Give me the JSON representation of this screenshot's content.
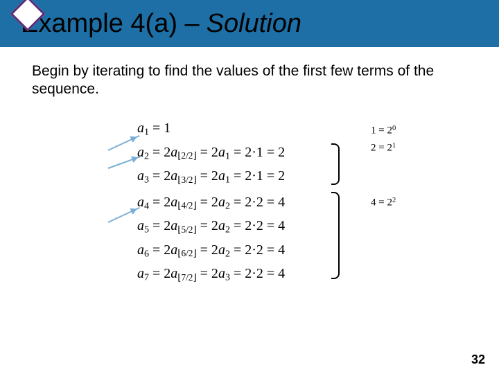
{
  "header": {
    "title_plain": "Example 4(a) – ",
    "title_italic": "Solution"
  },
  "body": {
    "text": "Begin by iterating to find the values of the first few terms of the sequence."
  },
  "equations": {
    "r1": "a₁ = 1",
    "r2": "a₂ = 2a⌊2/2⌋ = 2a₁ = 2·1 = 2",
    "r3": "a₃ = 2a⌊3/2⌋ = 2a₁ = 2·1 = 2",
    "r4": "a₄ = 2a⌊4/2⌋ = 2a₂ = 2·2 = 4",
    "r5": "a₅ = 2a⌊5/2⌋ = 2a₂ = 2·2 = 4",
    "r6": "a₆ = 2a⌊6/2⌋ = 2a₂ = 2·2 = 4",
    "r7": "a₇ = 2a⌊7/2⌋ = 2a₃ = 2·2 = 4"
  },
  "annotations": {
    "a1": "1 = 2⁰",
    "a2": "2 = 2¹",
    "a3": "4 = 2²"
  },
  "page": "32"
}
